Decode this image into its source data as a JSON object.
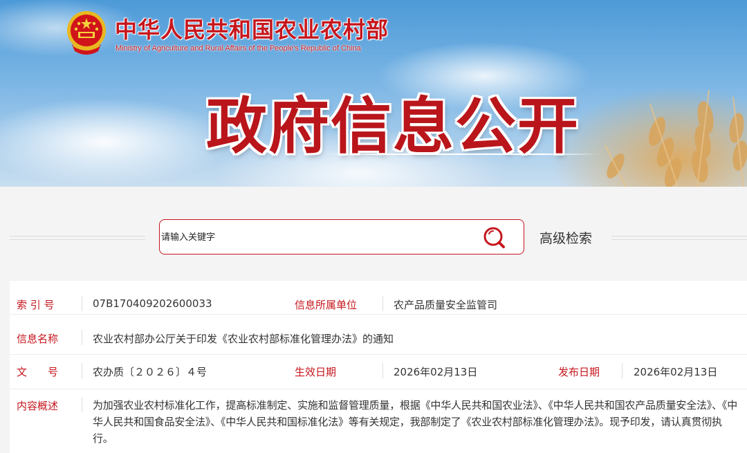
{
  "header": {
    "ministry_name_cn": "中华人民共和国农业农村部",
    "ministry_name_en": "Ministry of Agriculture and Rural Affairs of the People's Republic of China",
    "banner_title": "政府信息公开",
    "emblem_icon": "national-emblem-icon"
  },
  "search": {
    "placeholder": "请输入关键字",
    "search_icon": "search-icon",
    "advanced_label": "高级检索"
  },
  "info": {
    "index_label": "索 引 号",
    "index_value": "07B170409202600033",
    "dept_label": "信息所属单位",
    "dept_value": "农产品质量安全监管司",
    "name_label": "信息名称",
    "name_value": "农业农村部办公厅关于印发《农业农村部标准化管理办法》的通知",
    "docno_label": "文　　号",
    "docno_value": "农办质〔２０２６〕４号",
    "effective_label": "生效日期",
    "effective_value": "2026年02月13日",
    "publish_label": "发布日期",
    "publish_value": "2026年02月13日",
    "summary_label": "内容概述",
    "summary_value": "为加强农业农村标准化工作，提高标准制定、实施和监督管理质量，根据《中华人民共和国农业法》、《中华人民共和国农产品质量安全法》、《中华人民共和国食品安全法》、《中华人民共和国标准化法》等有关规定，我部制定了《农业农村部标准化管理办法》。现予印发，请认真贯彻执行。"
  },
  "colors": {
    "accent_red": "#c6161d",
    "text": "#333333",
    "background": "#f4f4f4"
  }
}
